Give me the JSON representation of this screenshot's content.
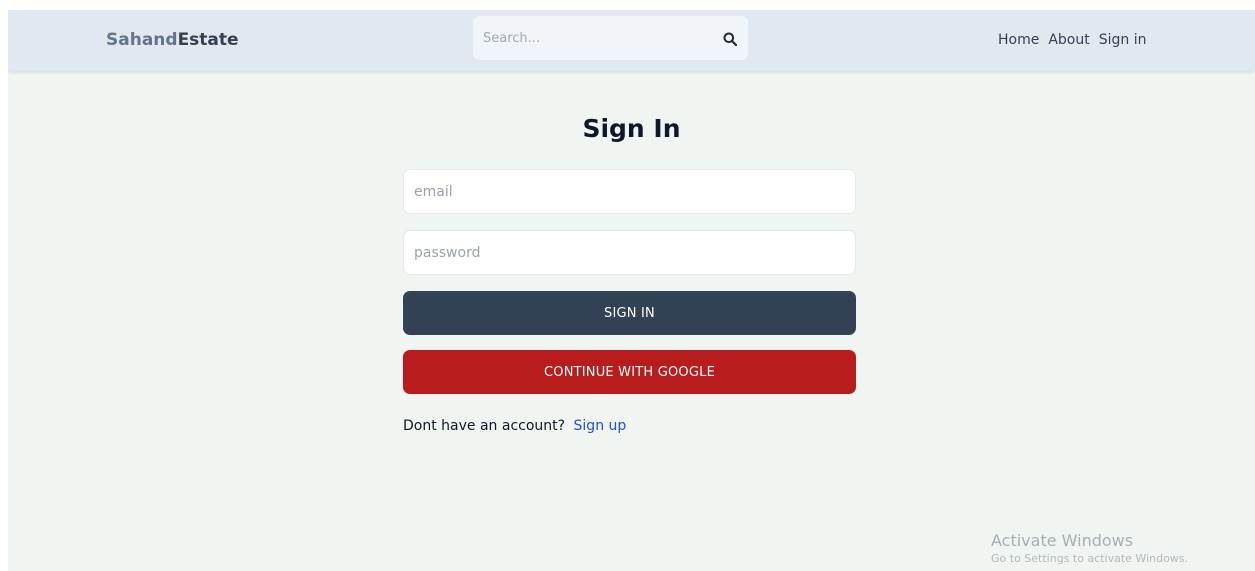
{
  "header": {
    "logo_part1": "Sahand",
    "logo_part2": "Estate",
    "search": {
      "placeholder": "Search...",
      "value": "",
      "icon": "search-icon"
    },
    "nav": {
      "home": "Home",
      "about": "About",
      "sign_in": "Sign in"
    }
  },
  "main": {
    "title": "Sign In",
    "email_placeholder": "email",
    "password_placeholder": "password",
    "sign_in_button": "SIGN IN",
    "google_button": "CONTINUE WITH GOOGLE",
    "account_prompt": "Dont have an account?",
    "sign_up_link": "Sign up"
  },
  "watermark": {
    "title": "Activate Windows",
    "subtitle": "Go to Settings to activate Windows."
  },
  "colors": {
    "header_bg": "#e2e8f0",
    "page_bg": "#f1f5f1",
    "primary_button": "#334155",
    "google_button": "#b91c1c",
    "link": "#1d4ed8"
  }
}
